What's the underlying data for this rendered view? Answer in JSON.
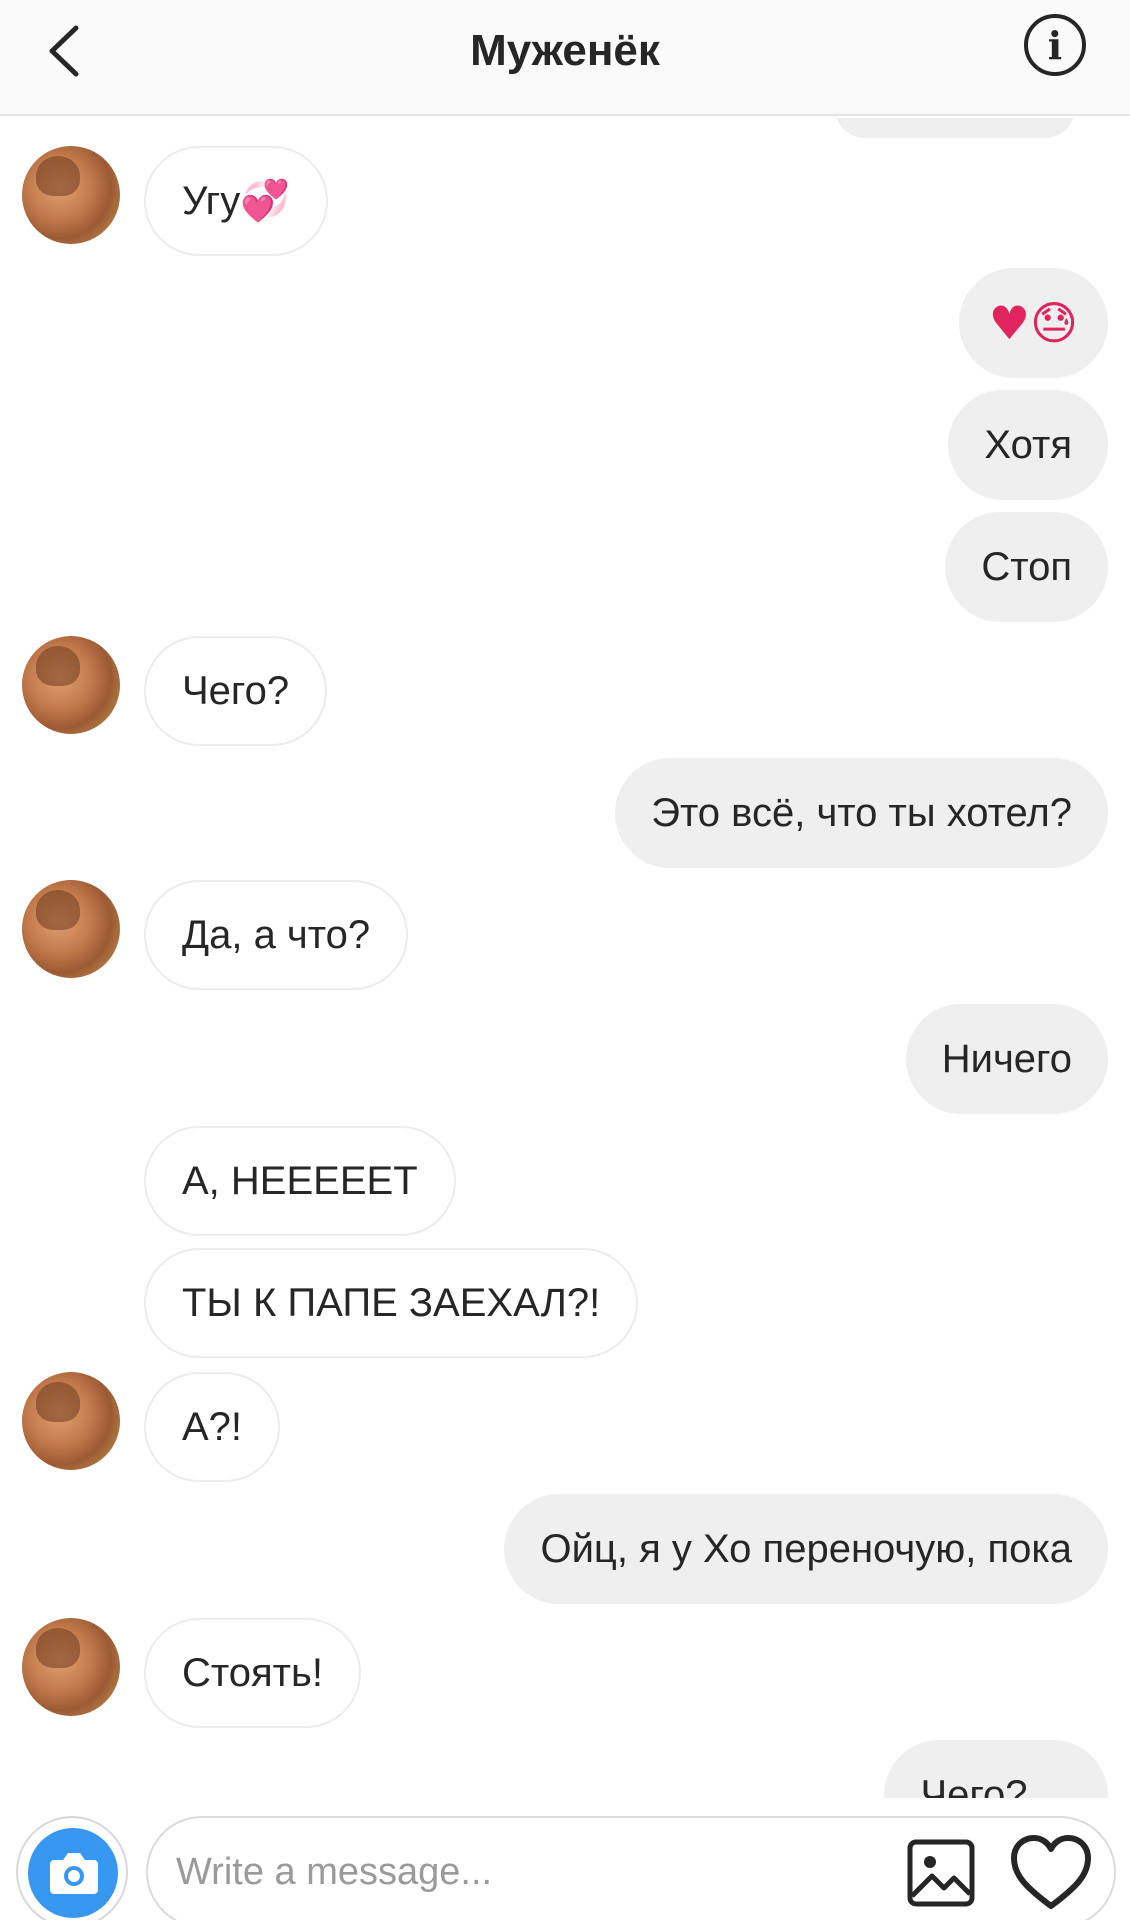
{
  "header": {
    "title": "Муженёк",
    "info_label": "i"
  },
  "messages": [
    {
      "side": "in",
      "avatar": true,
      "text": "Угу",
      "emoji": "💞"
    },
    {
      "side": "out",
      "text": "",
      "emoji": "♥😓"
    },
    {
      "side": "out",
      "text": "Хотя"
    },
    {
      "side": "out",
      "text": "Стоп"
    },
    {
      "side": "in",
      "avatar": true,
      "text": "Чего?"
    },
    {
      "side": "out",
      "text": "Это всё, что ты хотел?"
    },
    {
      "side": "in",
      "avatar": true,
      "text": "Да, а что?"
    },
    {
      "side": "out",
      "text": "Ничего"
    },
    {
      "side": "in",
      "avatar": false,
      "text": "А, НЕЕЕЕЕТ"
    },
    {
      "side": "in",
      "avatar": false,
      "text": "ТЫ К ПАПЕ ЗАЕХАЛ?!"
    },
    {
      "side": "in",
      "avatar": true,
      "text": "А?!"
    },
    {
      "side": "out",
      "text": "Ойц, я у Хо переночую, пока"
    },
    {
      "side": "in",
      "avatar": true,
      "text": "Стоять!"
    },
    {
      "side": "out",
      "text": "Чего?...."
    }
  ],
  "composer": {
    "placeholder": "Write a message...",
    "value": ""
  },
  "icons": {
    "back": "chevron-left-icon",
    "info": "info-icon",
    "camera": "camera-icon",
    "gallery": "gallery-icon",
    "like": "heart-icon"
  },
  "colors": {
    "accent": "#3897f0",
    "outgoing_bubble": "#efefef",
    "text": "#262626"
  }
}
